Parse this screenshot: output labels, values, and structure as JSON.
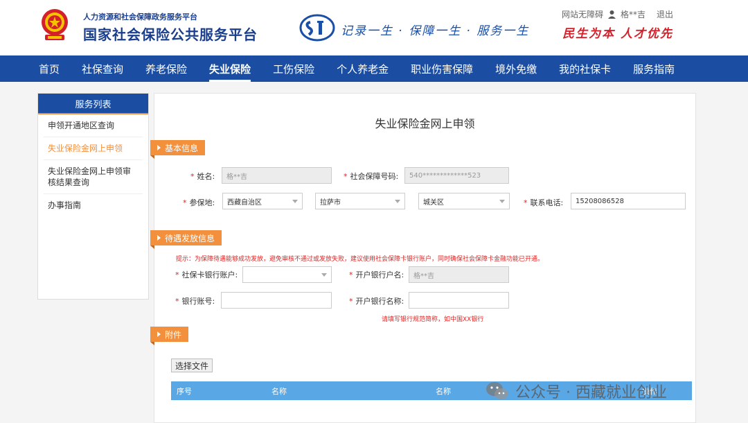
{
  "header": {
    "org_small": "人力资源和社会保障政务服务平台",
    "org_big": "国家社会保险公共服务平台",
    "slogan": "记录一生 · 保障一生 · 服务一生",
    "accessibility": "网站无障碍",
    "user": "格**吉",
    "logout": "退出",
    "motto": "民生为本  人才优先"
  },
  "nav": {
    "items": [
      "首页",
      "社保查询",
      "养老保险",
      "失业保险",
      "工伤保险",
      "个人养老金",
      "职业伤害保障",
      "境外免缴",
      "我的社保卡",
      "服务指南"
    ],
    "active": "失业保险"
  },
  "sidebar": {
    "title": "服务列表",
    "items": [
      "申领开通地区查询",
      "失业保险金网上申领",
      "失业保险金网上申领审核结果查询",
      "办事指南"
    ],
    "active_index": 1
  },
  "main": {
    "title": "失业保险金网上申领",
    "basic": {
      "tag": "基本信息",
      "name_label": "姓名:",
      "name_value": "格**吉",
      "ssn_label": "社会保障号码:",
      "ssn_value": "540*************523",
      "place_label": "参保地:",
      "province": "西藏自治区",
      "city": "拉萨市",
      "district": "城关区",
      "phone_label": "联系电话:",
      "phone_value": "15208086528"
    },
    "payment": {
      "tag": "待遇发放信息",
      "hint": "提示：为保障待遇能够成功发放，避免审核不通过或发放失败，建议使用社会保障卡银行账户，同时确保社会保障卡金融功能已开通。",
      "card_account_label": "社保卡银行账户:",
      "card_account_value": "",
      "holder_label": "开户银行户名:",
      "holder_value": "格**吉",
      "account_label": "银行账号:",
      "account_value": "",
      "bank_name_label": "开户银行名称:",
      "bank_name_value": "",
      "bank_name_hint": "请填写银行规范简称，如中国XX银行"
    },
    "attachment": {
      "tag": "附件",
      "choose_file": "选择文件",
      "columns": [
        "序号",
        "名称",
        "名称",
        "操作"
      ]
    }
  },
  "watermark": {
    "text": "公众号 · 西藏就业创业"
  },
  "colors": {
    "nav_bg": "#1b4ea3",
    "accent_orange": "#f2903d",
    "required_red": "#e02424",
    "table_head": "#5aa7e6"
  }
}
